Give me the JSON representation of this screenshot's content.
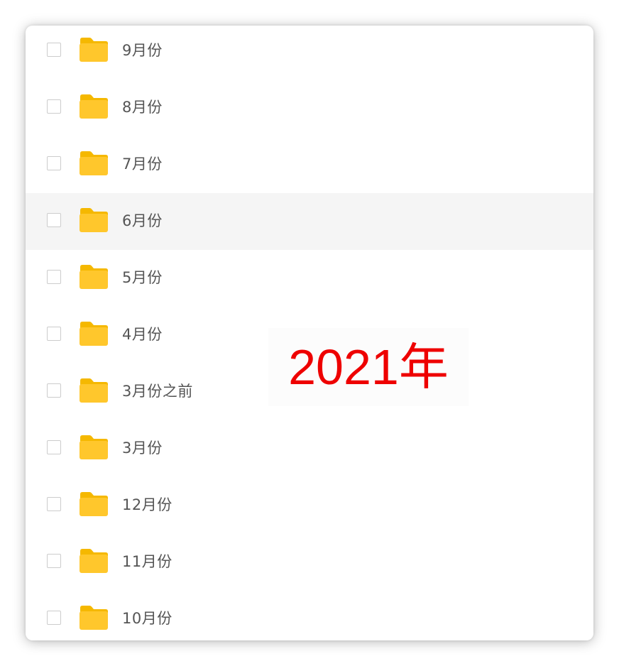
{
  "folders": [
    {
      "name": "9月份",
      "checked": false
    },
    {
      "name": "8月份",
      "checked": false
    },
    {
      "name": "7月份",
      "checked": false
    },
    {
      "name": "6月份",
      "checked": false
    },
    {
      "name": "5月份",
      "checked": false
    },
    {
      "name": "4月份",
      "checked": false
    },
    {
      "name": "3月份之前",
      "checked": false
    },
    {
      "name": "3月份",
      "checked": false
    },
    {
      "name": "12月份",
      "checked": false
    },
    {
      "name": "11月份",
      "checked": false
    },
    {
      "name": "10月份",
      "checked": false
    }
  ],
  "hovered_row": "6月份",
  "overlay_text": "2021年",
  "icon": "folder-icon",
  "colors": {
    "folder": "#FFC72C",
    "folder_tab": "#F5B800",
    "overlay_text": "#EE0000",
    "hover_row": "#F5F5F5",
    "label": "#555555"
  }
}
